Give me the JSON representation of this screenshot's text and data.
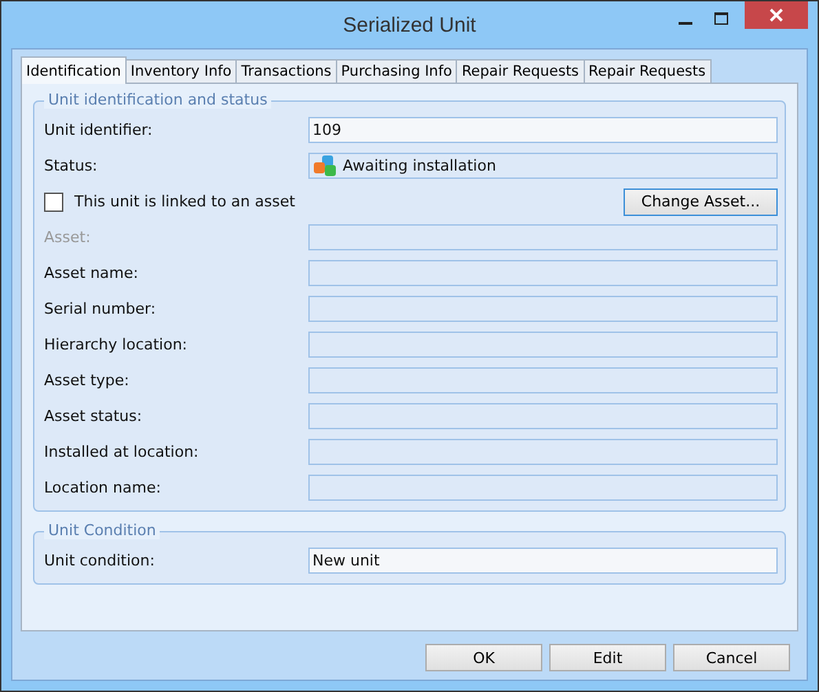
{
  "window": {
    "title": "Serialized Unit"
  },
  "tabs": [
    {
      "label": "Identification",
      "selected": true
    },
    {
      "label": "Inventory Info",
      "selected": false
    },
    {
      "label": "Transactions",
      "selected": false
    },
    {
      "label": "Purchasing Info",
      "selected": false
    },
    {
      "label": "Repair Requests",
      "selected": false
    },
    {
      "label": "Repair Requests",
      "selected": false
    }
  ],
  "groups": [
    {
      "title": "Unit identification and status",
      "rows": [
        {
          "kind": "field",
          "label": "Unit identifier:",
          "value": "109",
          "disabled": false
        },
        {
          "kind": "status",
          "label": "Status:",
          "value": "Awaiting installation",
          "disabled": false
        },
        {
          "kind": "check",
          "label": "This unit is linked to an asset",
          "checked": false,
          "button": "Change Asset..."
        },
        {
          "kind": "field",
          "label": "Asset:",
          "disabled": true
        },
        {
          "kind": "field",
          "label": "Asset name:",
          "disabled": false
        },
        {
          "kind": "field",
          "label": "Serial number:",
          "disabled": false
        },
        {
          "kind": "field",
          "label": "Hierarchy location:",
          "disabled": false
        },
        {
          "kind": "field",
          "label": "Asset type:",
          "disabled": false
        },
        {
          "kind": "field",
          "label": "Asset status:",
          "disabled": false
        },
        {
          "kind": "field",
          "label": "Installed at location:",
          "disabled": false
        },
        {
          "kind": "field",
          "label": "Location name:",
          "disabled": false
        }
      ]
    },
    {
      "title": "Unit Condition",
      "rows": [
        {
          "kind": "field",
          "label": "Unit condition:",
          "value": "New unit",
          "disabled": false
        }
      ]
    }
  ],
  "buttons": [
    "OK",
    "Edit",
    "Cancel"
  ]
}
